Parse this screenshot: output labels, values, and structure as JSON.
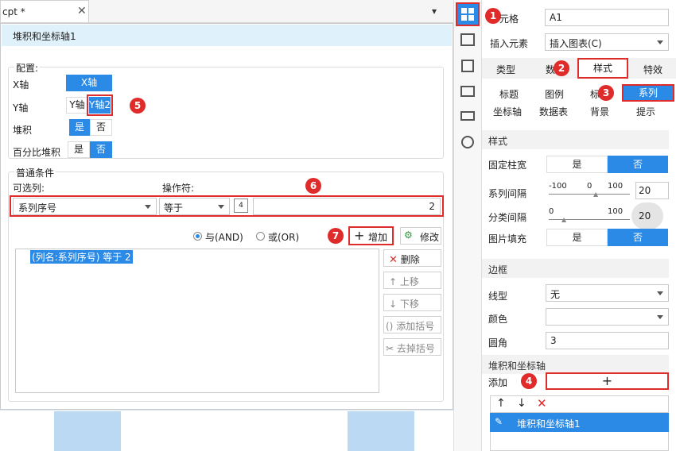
{
  "tab": {
    "name": "cpt *"
  },
  "dialog": {
    "title": "堆积和坐标轴1"
  },
  "config": {
    "legend": "配置:",
    "x_axis_label": "X轴",
    "x_axis_value": "X轴",
    "y_axis_label": "Y轴",
    "y1": "Y轴",
    "y2": "Y轴2",
    "stack_label": "堆积",
    "yes": "是",
    "no": "否",
    "percent_label": "百分比堆积"
  },
  "condition": {
    "legend": "普通条件",
    "column_label": "可选列:",
    "operator_label": "操作符:",
    "column_value": "系列序号",
    "operator_value": "等于",
    "value": "2",
    "and_label": "与(AND)",
    "or_label": "或(OR)",
    "add_label": "增加",
    "edit_label": "修改",
    "list": [
      "(列名:系列序号) 等于 2"
    ],
    "delete_label": "删除",
    "up_label": "上移",
    "down_label": "下移",
    "add_paren_label": "添加括号",
    "remove_paren_label": "去掉括号"
  },
  "right": {
    "cell_label": "元格",
    "cell_value": "A1",
    "insert_label": "插入元素",
    "insert_value": "插入图表(C)",
    "tabs": [
      "类型",
      "数",
      "样式",
      "特效"
    ],
    "subtabs_row1": [
      "标题",
      "图例",
      "标",
      "系列"
    ],
    "subtabs_row2": [
      "坐标轴",
      "数据表",
      "背景",
      "提示"
    ],
    "style_section": "样式",
    "fixed_width": "固定柱宽",
    "yes": "是",
    "no": "否",
    "series_gap": "系列间隔",
    "series_gap_ticks": [
      "-100",
      "0",
      "100"
    ],
    "series_gap_value": "20",
    "category_gap": "分类间隔",
    "category_gap_ticks": [
      "0",
      "100"
    ],
    "category_gap_value": "20",
    "image_fill": "图片填充",
    "border_section": "边框",
    "line_type": "线型",
    "line_type_value": "无",
    "color_label": "颜色",
    "radius_label": "圆角",
    "radius_value": "3",
    "stack_section": "堆积和坐标轴",
    "add_label": "添加",
    "plus": "+",
    "stack_item": "堆积和坐标轴1"
  },
  "markers": [
    "1",
    "2",
    "3",
    "4",
    "5",
    "6",
    "7"
  ],
  "colors": {
    "accent": "#2a8ae5",
    "red": "#e02b2b",
    "title_bg": "#dff1fb"
  }
}
